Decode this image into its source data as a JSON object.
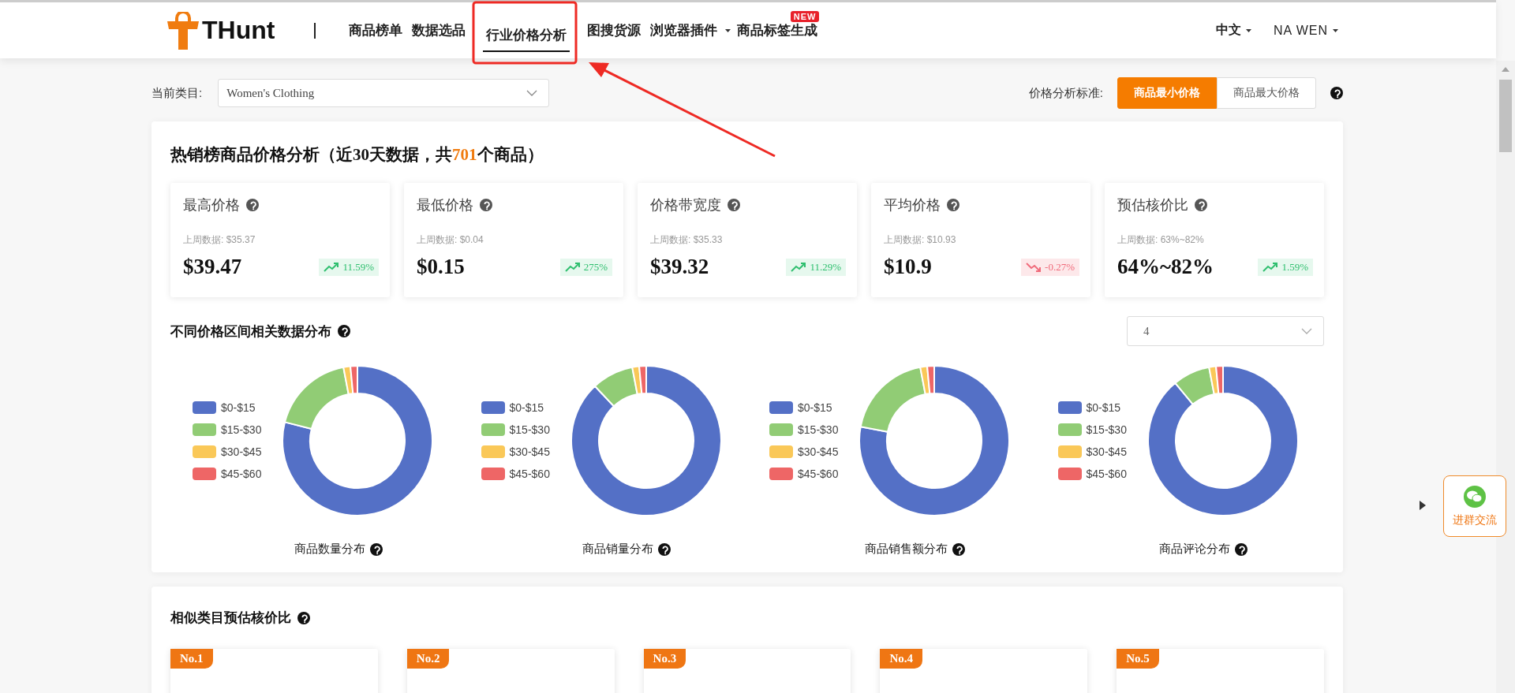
{
  "logo": {
    "text": "THunt"
  },
  "nav": [
    {
      "label": "商品榜单",
      "selected": false
    },
    {
      "label": "数据选品",
      "selected": false
    },
    {
      "label": "行业价格分析",
      "selected": true
    },
    {
      "label": "图搜货源",
      "selected": false
    },
    {
      "label": "浏览器插件",
      "selected": false,
      "dropdown": true
    },
    {
      "label": "商品标签生成",
      "selected": false,
      "badge": "NEW"
    }
  ],
  "language": "中文",
  "user": "NA WEN",
  "category": {
    "label": "当前类目:",
    "value": "Women's Clothing"
  },
  "price_standard": {
    "label": "价格分析标准:",
    "options": [
      {
        "label": "商品最小价格",
        "selected": true
      },
      {
        "label": "商品最大价格",
        "selected": false
      }
    ]
  },
  "analysis": {
    "title_prefix": "热销榜商品价格分析（近",
    "days": "30",
    "title_mid": "天数据，共",
    "count": "701",
    "title_suffix": "个商品）",
    "stats": [
      {
        "label": "最高价格",
        "last_week": "上周数据: $35.37",
        "value": "$39.47",
        "change": "11.59%",
        "rising": true
      },
      {
        "label": "最低价格",
        "last_week": "上周数据: $0.04",
        "value": "$0.15",
        "change": "275%",
        "rising": true
      },
      {
        "label": "价格带宽度",
        "last_week": "上周数据: $35.33",
        "value": "$39.32",
        "change": "11.29%",
        "rising": true
      },
      {
        "label": "平均价格",
        "last_week": "上周数据: $10.93",
        "value": "$10.9",
        "change": "-0.27%",
        "rising": false
      },
      {
        "label": "预估核价比",
        "last_week": "上周数据: 63%~82%",
        "value": "64%~82%",
        "change": "1.59%",
        "rising": true
      }
    ],
    "distribution": {
      "title": "不同价格区间相关数据分布",
      "select_value": "4",
      "charts": [
        {
          "caption": "商品数量分布",
          "legend": [
            {
              "label": "$0-$15",
              "color": "#5470c6"
            },
            {
              "label": "$15-$30",
              "color": "#91cc75"
            },
            {
              "label": "$30-$45",
              "color": "#fac858"
            },
            {
              "label": "$45-$60",
              "color": "#ee6666"
            }
          ]
        },
        {
          "caption": "商品销量分布",
          "legend": [
            {
              "label": "$0-$15",
              "color": "#5470c6"
            },
            {
              "label": "$15-$30",
              "color": "#91cc75"
            },
            {
              "label": "$30-$45",
              "color": "#fac858"
            },
            {
              "label": "$45-$60",
              "color": "#ee6666"
            }
          ]
        },
        {
          "caption": "商品销售额分布",
          "legend": [
            {
              "label": "$0-$15",
              "color": "#5470c6"
            },
            {
              "label": "$15-$30",
              "color": "#91cc75"
            },
            {
              "label": "$30-$45",
              "color": "#fac858"
            },
            {
              "label": "$45-$60",
              "color": "#ee6666"
            }
          ]
        },
        {
          "caption": "商品评论分布",
          "legend": [
            {
              "label": "$0-$15",
              "color": "#5470c6"
            },
            {
              "label": "$15-$30",
              "color": "#91cc75"
            },
            {
              "label": "$30-$45",
              "color": "#fac858"
            },
            {
              "label": "$45-$60",
              "color": "#ee6666"
            }
          ]
        }
      ]
    }
  },
  "similar": {
    "title": "相似类目预估核价比",
    "ranks": [
      "No.1",
      "No.2",
      "No.3",
      "No.4",
      "No.5"
    ]
  },
  "widget": {
    "label": "进群交流"
  }
}
